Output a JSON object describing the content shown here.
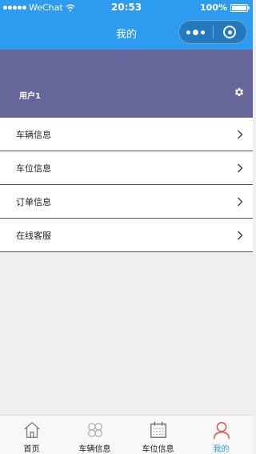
{
  "status_bar": {
    "carrier": "WeChat",
    "time": "20:53",
    "battery": "100%"
  },
  "nav": {
    "title": "我的"
  },
  "profile": {
    "username": "用户1"
  },
  "menu": {
    "items": [
      {
        "label": "车辆信息"
      },
      {
        "label": "车位信息"
      },
      {
        "label": "订单信息"
      },
      {
        "label": "在线客服"
      }
    ]
  },
  "tabbar": {
    "active_color": "#2d9bf0",
    "tabs": [
      {
        "label": "首页",
        "icon": "home-icon"
      },
      {
        "label": "车辆信息",
        "icon": "clover-icon"
      },
      {
        "label": "车位信息",
        "icon": "calendar-icon"
      },
      {
        "label": "我的",
        "icon": "user-icon"
      }
    ]
  },
  "theme": {
    "primary": "#2d9bf0",
    "profile_bg": "#67669a"
  }
}
